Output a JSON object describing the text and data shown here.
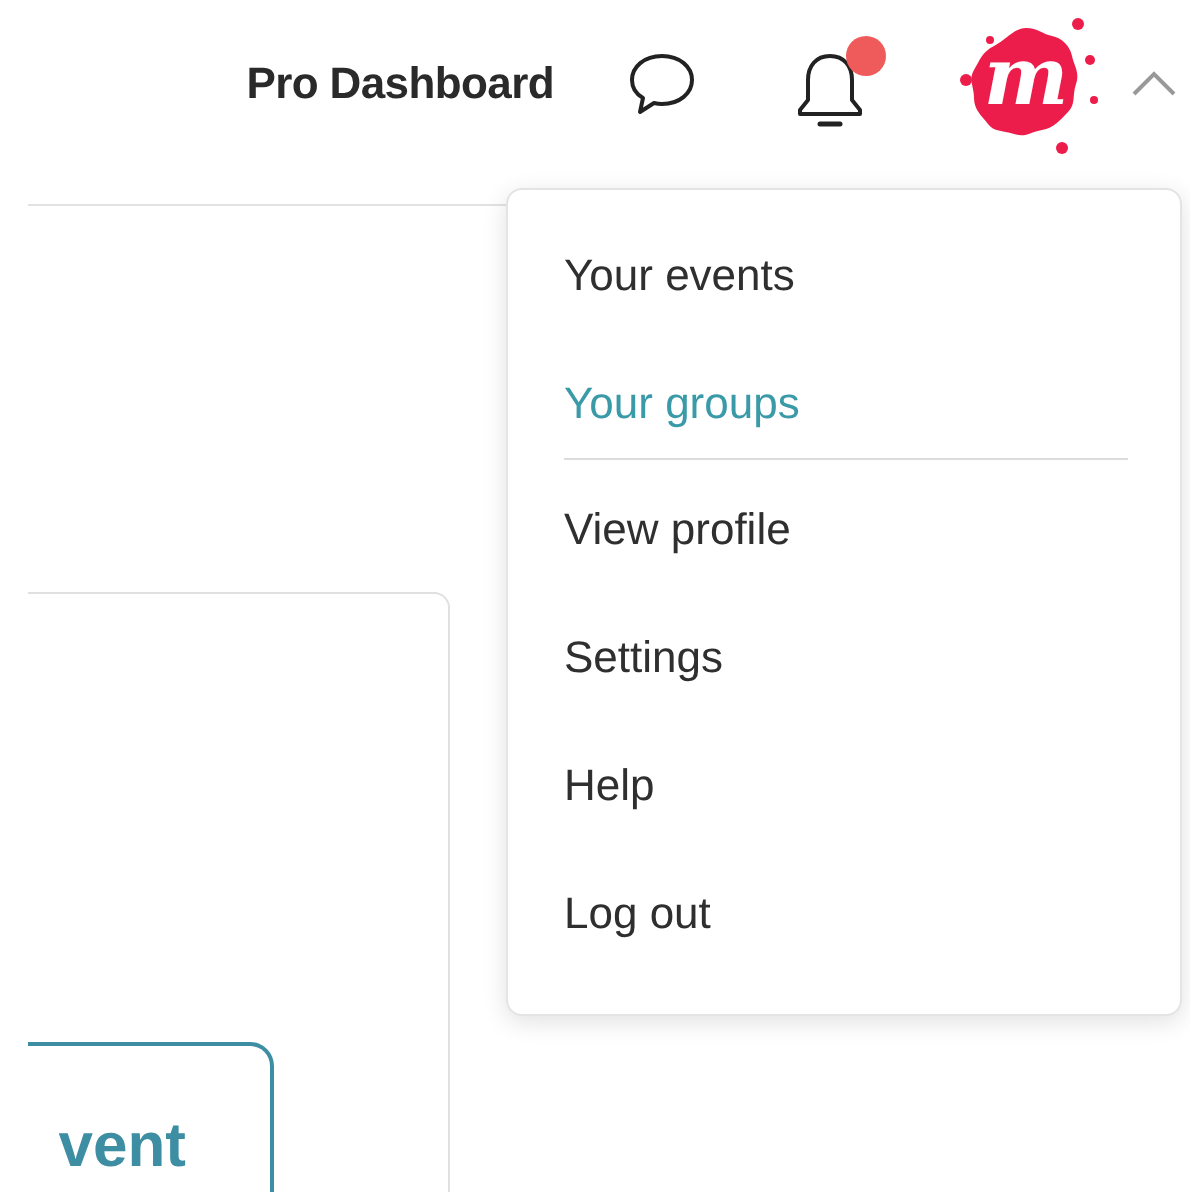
{
  "header": {
    "dashboard_link": "Pro Dashboard",
    "notifications": {
      "unread": true
    },
    "avatar": {
      "letter": "m"
    },
    "menu_open": true
  },
  "account_menu": {
    "sections": [
      [
        {
          "label": "Your events",
          "selected": false
        },
        {
          "label": "Your groups",
          "selected": true
        }
      ],
      [
        {
          "label": "View profile",
          "selected": false
        },
        {
          "label": "Settings",
          "selected": false
        },
        {
          "label": "Help",
          "selected": false
        },
        {
          "label": "Log out",
          "selected": false
        }
      ]
    ]
  },
  "card": {
    "button": "vent"
  }
}
